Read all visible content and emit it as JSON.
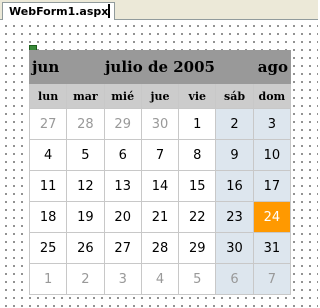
{
  "tab": {
    "label": "WebForm1.aspx"
  },
  "calendar": {
    "prev": "jun",
    "title": "julio de 2005",
    "next": "ago",
    "days_of_week": [
      "lun",
      "mar",
      "mié",
      "jue",
      "vie",
      "sáb",
      "dom"
    ],
    "weeks": [
      [
        {
          "d": "27",
          "other": true
        },
        {
          "d": "28",
          "other": true
        },
        {
          "d": "29",
          "other": true
        },
        {
          "d": "30",
          "other": true
        },
        {
          "d": "1"
        },
        {
          "d": "2",
          "weekend": true
        },
        {
          "d": "3",
          "weekend": true
        }
      ],
      [
        {
          "d": "4"
        },
        {
          "d": "5"
        },
        {
          "d": "6"
        },
        {
          "d": "7"
        },
        {
          "d": "8"
        },
        {
          "d": "9",
          "weekend": true
        },
        {
          "d": "10",
          "weekend": true
        }
      ],
      [
        {
          "d": "11"
        },
        {
          "d": "12"
        },
        {
          "d": "13"
        },
        {
          "d": "14"
        },
        {
          "d": "15"
        },
        {
          "d": "16",
          "weekend": true
        },
        {
          "d": "17",
          "weekend": true
        }
      ],
      [
        {
          "d": "18"
        },
        {
          "d": "19"
        },
        {
          "d": "20"
        },
        {
          "d": "21"
        },
        {
          "d": "22"
        },
        {
          "d": "23",
          "weekend": true
        },
        {
          "d": "24",
          "weekend": true,
          "today": true
        }
      ],
      [
        {
          "d": "25"
        },
        {
          "d": "26"
        },
        {
          "d": "27"
        },
        {
          "d": "28"
        },
        {
          "d": "29"
        },
        {
          "d": "30",
          "weekend": true
        },
        {
          "d": "31",
          "weekend": true
        }
      ],
      [
        {
          "d": "1",
          "other": true
        },
        {
          "d": "2",
          "other": true
        },
        {
          "d": "3",
          "other": true
        },
        {
          "d": "4",
          "other": true
        },
        {
          "d": "5",
          "other": true
        },
        {
          "d": "6",
          "other": true,
          "weekend": true
        },
        {
          "d": "7",
          "other": true,
          "weekend": true
        }
      ]
    ]
  },
  "colors": {
    "title_bg": "#999999",
    "dow_bg": "#cccccc",
    "weekend_bg": "#dde6ee",
    "today_bg": "#ff9900",
    "other_month_text": "#999999"
  }
}
